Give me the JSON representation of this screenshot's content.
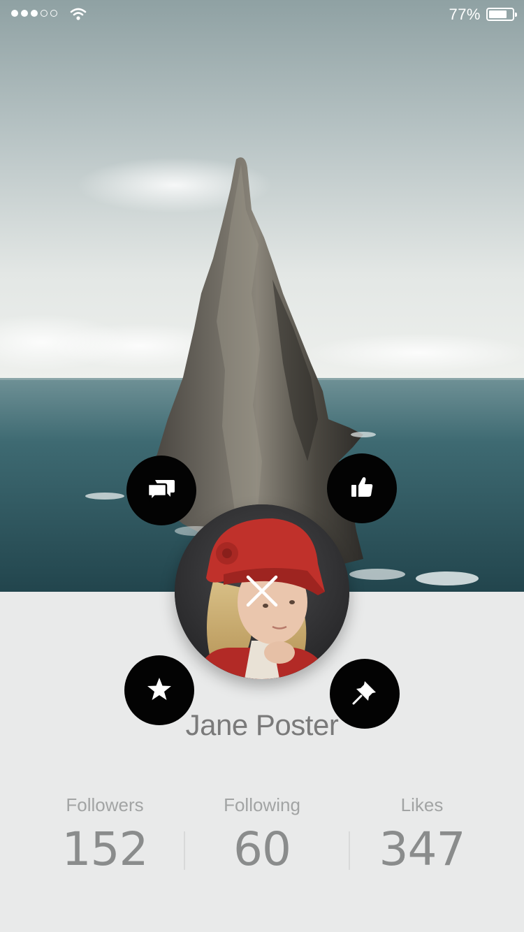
{
  "status_bar": {
    "signal_dots_on": 3,
    "signal_dots_total": 5,
    "wifi_icon": "wifi-icon",
    "battery_percent": "77%",
    "battery_level": 0.77
  },
  "hero": {
    "image": "sea-stack-photo",
    "colors": {
      "sky": "#c9d3d3",
      "sea": "#2f5a62",
      "rock": "#4d4a45"
    }
  },
  "actions": {
    "chat_icon": "chat-bubbles-icon",
    "like_icon": "thumbs-up-icon",
    "favorite_icon": "star-icon",
    "pin_icon": "pushpin-icon",
    "close_icon": "close-icon",
    "button_color": "#030303"
  },
  "profile": {
    "name": "Jane Poster",
    "avatar": "girl-red-hat-avatar"
  },
  "stats": {
    "followers_label": "Followers",
    "followers_value": "152",
    "following_label": "Following",
    "following_value": "60",
    "likes_label": "Likes",
    "likes_value": "347"
  },
  "colors": {
    "background": "#e9eaea",
    "name_text": "#7a7a7a",
    "label_text": "#a2a4a4",
    "value_text": "#8a8c8c"
  }
}
